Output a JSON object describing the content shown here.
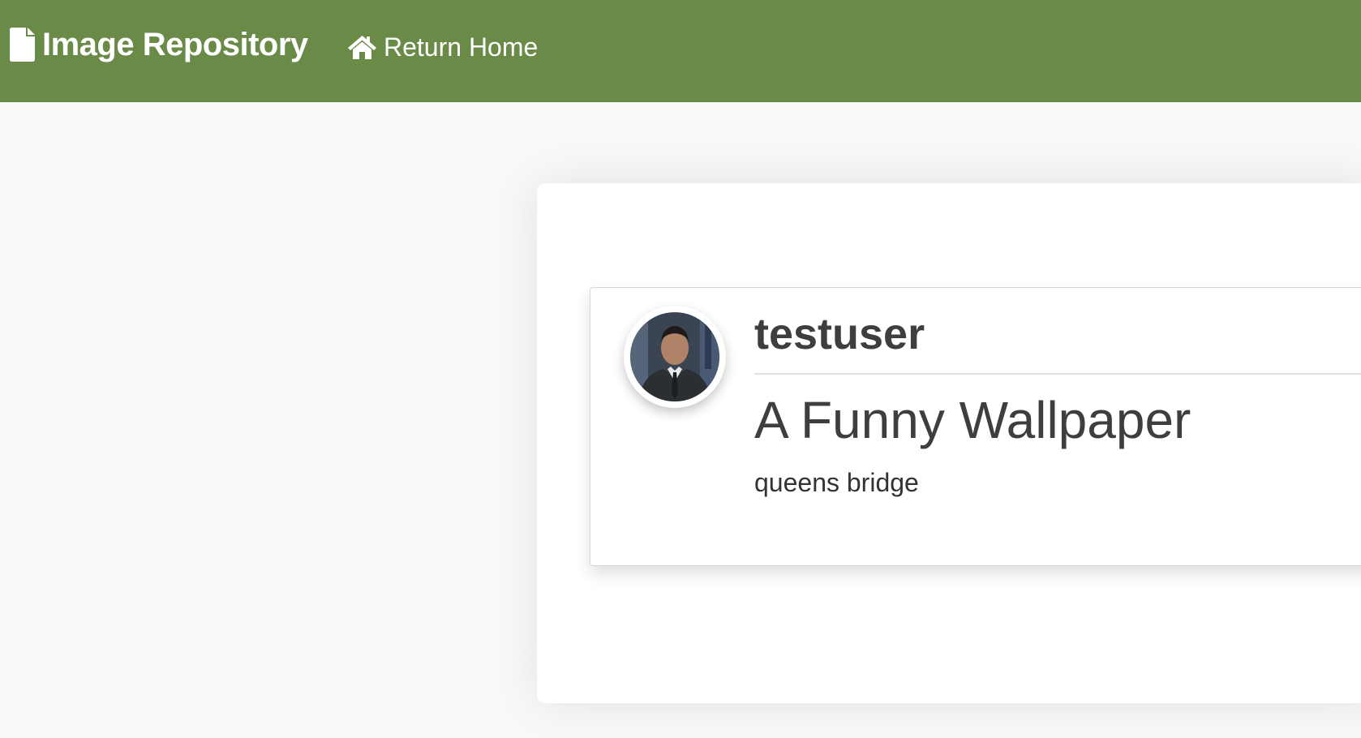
{
  "navbar": {
    "brand_icon": "file-icon",
    "brand": "Image Repository",
    "home_icon": "home-icon",
    "return_home": "Return Home",
    "bg_color": "#6a8b47"
  },
  "post": {
    "avatar_alt": "profile photo",
    "username": "testuser",
    "title": "A Funny Wallpaper",
    "description": "queens bridge"
  }
}
